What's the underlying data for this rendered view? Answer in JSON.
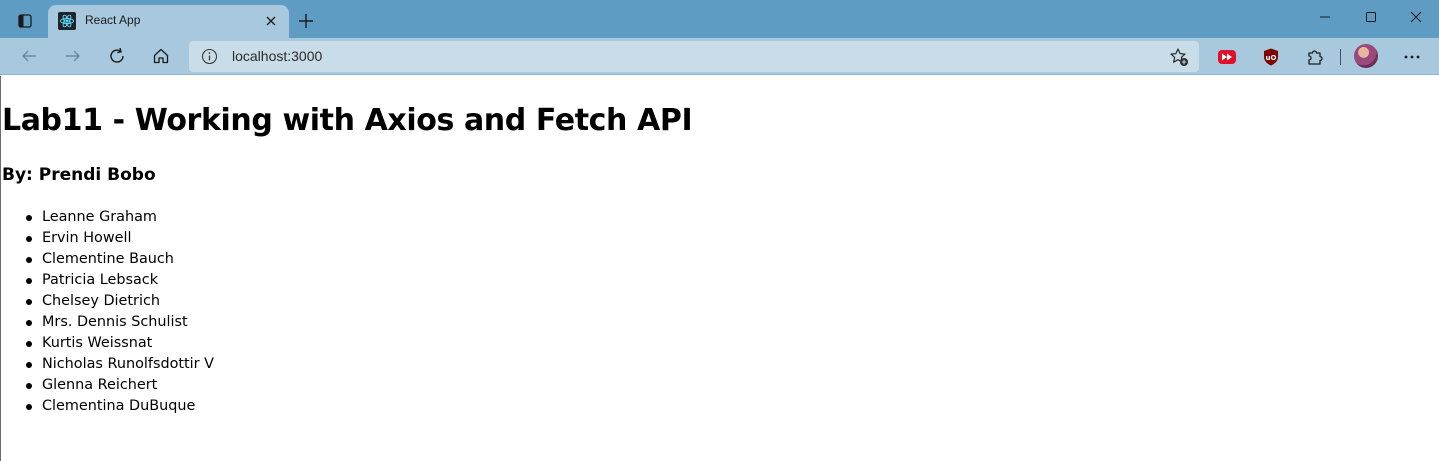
{
  "browser": {
    "tab": {
      "title": "React App"
    },
    "address_bar": {
      "url": "localhost:3000"
    },
    "icons": {
      "tab_actions": "tab-actions-icon",
      "favicon": "react-logo-icon",
      "close": "close-icon",
      "new_tab": "plus-icon",
      "back": "arrow-left-icon",
      "forward": "arrow-right-icon",
      "refresh": "refresh-icon",
      "home": "home-icon",
      "info": "info-icon",
      "favorites": "star-plus-icon",
      "extension_1": "media-extension-icon",
      "extension_2": "ublock-shield-icon",
      "extensions": "puzzle-icon",
      "profile": "avatar",
      "menu": "more-icon"
    },
    "colors": {
      "titlebar": "#5f9cc3",
      "toolbar": "#a7c8dd",
      "address_bar": "#c9dde9"
    }
  },
  "page": {
    "heading": "Lab11 - Working with Axios and Fetch API",
    "subheading": "By: Prendi Bobo",
    "users": [
      "Leanne Graham",
      "Ervin Howell",
      "Clementine Bauch",
      "Patricia Lebsack",
      "Chelsey Dietrich",
      "Mrs. Dennis Schulist",
      "Kurtis Weissnat",
      "Nicholas Runolfsdottir V",
      "Glenna Reichert",
      "Clementina DuBuque"
    ]
  }
}
